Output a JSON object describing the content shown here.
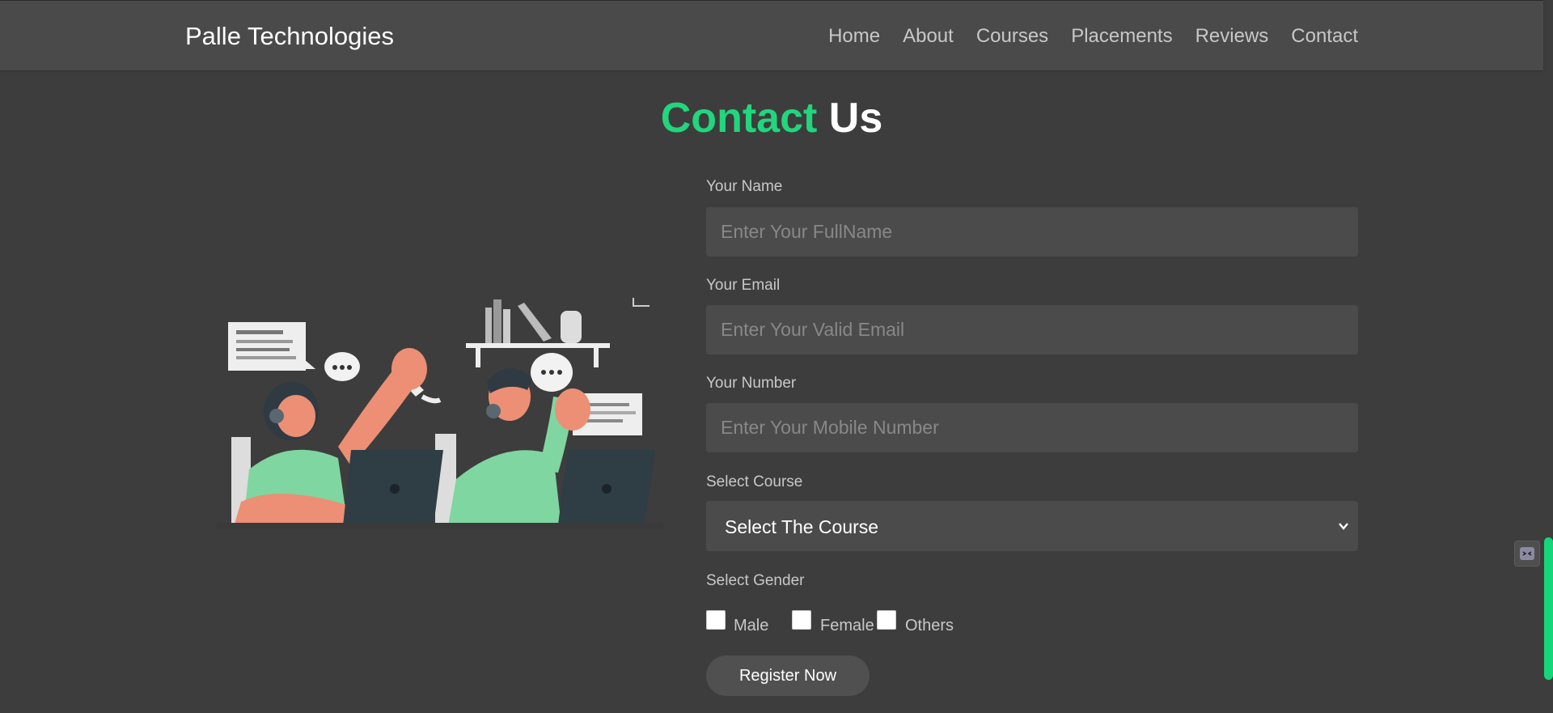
{
  "nav": {
    "brand": "Palle Technologies",
    "links": [
      "Home",
      "About",
      "Courses",
      "Placements",
      "Reviews",
      "Contact"
    ]
  },
  "title": {
    "accent": "Contact",
    "rest": "Us"
  },
  "form": {
    "name": {
      "label": "Your Name",
      "placeholder": "Enter Your FullName"
    },
    "email": {
      "label": "Your Email",
      "placeholder": "Enter Your Valid Email"
    },
    "number": {
      "label": "Your Number",
      "placeholder": "Enter Your Mobile Number"
    },
    "course": {
      "label": "Select Course",
      "value": "Select The Course"
    },
    "gender": {
      "label": "Select Gender",
      "options": [
        "Male",
        "Female",
        "Others"
      ]
    },
    "submit": "Register Now"
  },
  "colors": {
    "accent": "#21d67c",
    "background": "#3d3d3d",
    "navbar": "#4a4a4a",
    "input": "#4b4b4b"
  }
}
